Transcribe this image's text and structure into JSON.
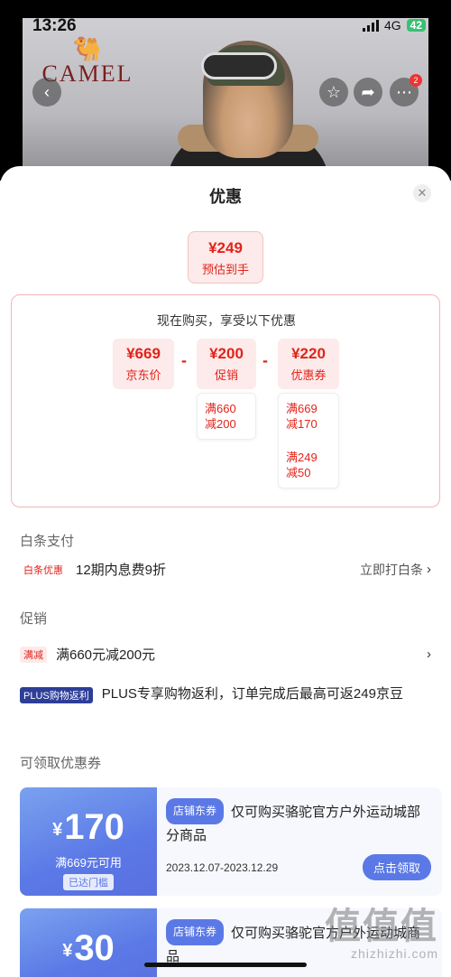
{
  "status_bar": {
    "time": "13:26",
    "network": "4G",
    "battery": "42"
  },
  "product": {
    "brand": "CAMEL",
    "cart_badge": "2"
  },
  "sheet": {
    "title": "优惠",
    "estimate": {
      "price": "¥249",
      "label": "预估到手"
    },
    "calc": {
      "title": "现在购买，享受以下优惠",
      "items": [
        {
          "value": "¥669",
          "label": "京东价"
        },
        {
          "value": "¥200",
          "label": "促销"
        },
        {
          "value": "¥220",
          "label": "优惠券"
        }
      ],
      "operators": [
        "-",
        "-"
      ],
      "promo_rules": [
        "满660",
        "减200"
      ],
      "coupon_rules": [
        {
          "line1": "满669",
          "line2": "减170"
        },
        {
          "line1": "满249",
          "line2": "减50"
        }
      ]
    },
    "baitiao": {
      "heading": "白条支付",
      "tag": "白条优惠",
      "text": "12期内息费9折",
      "action": "立即打白条"
    },
    "promotion": {
      "heading": "促销",
      "rows": [
        {
          "tag": "满减",
          "text": "满660元减200元"
        },
        {
          "tag": "PLUS购物返利",
          "text": "PLUS专享购物返利，订单完成后最高可返249京豆"
        }
      ]
    },
    "coupons": {
      "heading": "可领取优惠券",
      "items": [
        {
          "yen": "¥",
          "amount": "170",
          "condition": "满669元可用",
          "reached": "已达门槛",
          "tag": "店铺东券",
          "desc": "仅可购买骆驼官方户外运动城部分商品",
          "date": "2023.12.07-2023.12.29",
          "button": "点击领取"
        },
        {
          "yen": "¥",
          "amount": "30",
          "tag": "店铺东券",
          "desc": "仅可购买骆驼官方户外运动城商品"
        }
      ]
    }
  },
  "watermark": {
    "logo": "值值值",
    "url": "zhizhizhi.com"
  },
  "colors": {
    "accent_red": "#e2231a",
    "coupon_blue": "#5b79e6",
    "plus_navy": "#2c3e97"
  },
  "icons": [
    "back-icon",
    "favorite-icon",
    "share-icon",
    "more-icon",
    "close-icon",
    "chevron-right-icon"
  ]
}
